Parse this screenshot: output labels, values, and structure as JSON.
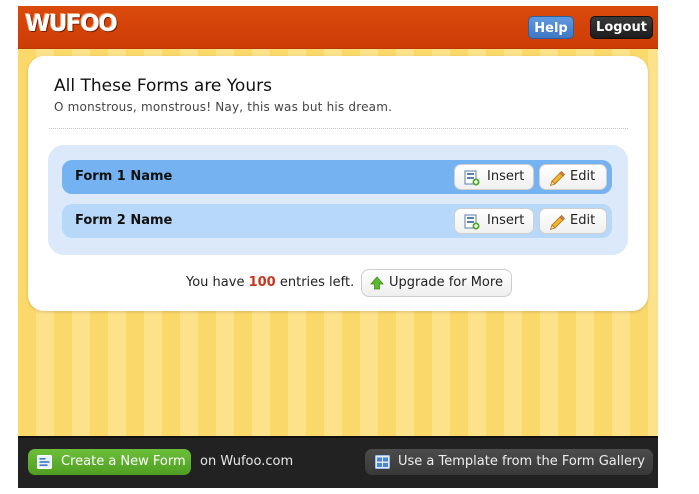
{
  "header": {
    "logo_text": "WUFOO",
    "help_label": "Help",
    "logout_label": "Logout"
  },
  "main": {
    "title": "All These Forms are Yours",
    "subtitle": "O monstrous, monstrous! Nay, this was but his dream.",
    "forms": [
      {
        "name": "Form 1 Name",
        "insert_label": "Insert",
        "edit_label": "Edit",
        "insert_icon": "insert-form-icon",
        "edit_icon": "pencil-icon"
      },
      {
        "name": "Form 2 Name",
        "insert_label": "Insert",
        "edit_label": "Edit",
        "insert_icon": "insert-form-icon",
        "edit_icon": "pencil-icon"
      }
    ],
    "entries": {
      "prefix": "You have",
      "count": "100",
      "suffix": "entries left."
    },
    "upgrade_label": "Upgrade for More",
    "upgrade_icon": "up-arrow-icon"
  },
  "footer": {
    "create_label": "Create a New Form",
    "create_icon": "new-form-icon",
    "on_site_text": "on Wufoo.com",
    "template_label": "Use a Template from the Form Gallery",
    "template_icon": "template-gallery-icon"
  },
  "colors": {
    "header_bar": "#d4420a",
    "background_stripe_a": "#fbd86a",
    "background_stripe_b": "#fde28a",
    "form_row_active": "#74b2f1",
    "form_row_inactive": "#b7d8f8",
    "help_button": "#4a86d4",
    "logout_button": "#262626",
    "create_button": "#5cae2c",
    "footer_bar": "#222222",
    "entries_count": "#c7361d"
  }
}
